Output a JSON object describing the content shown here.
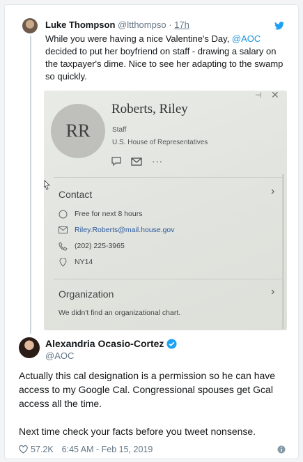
{
  "quoted_tweet": {
    "author_name": "Luke Thompson",
    "author_handle": "@ltthompso",
    "separator": "·",
    "time": "17h",
    "text_before": "While you were having a nice Valentine's Day, ",
    "mention": "@AOC",
    "text_after": " decided to put her boyfriend on staff - drawing a salary on the taxpayer's dime. Nice to see her adapting to the swamp so quickly."
  },
  "photo": {
    "pin_glyph": "⊣",
    "close_glyph": "✕",
    "initials": "RR",
    "name": "Roberts, Riley",
    "role": "Staff",
    "organization": "U.S. House of Representatives",
    "more_glyph": "···",
    "contact_header": "Contact",
    "chevron_glyph": "›",
    "contact_rows": [
      {
        "icon": "clock-icon",
        "text": "Free for next 8 hours"
      },
      {
        "icon": "mail-icon",
        "text": "Riley.Roberts@mail.house.gov"
      },
      {
        "icon": "phone-icon",
        "text": "(202) 225-3965"
      },
      {
        "icon": "location-icon",
        "text": "NY14"
      }
    ],
    "org_header": "Organization",
    "org_note": "We didn't find an organizational chart."
  },
  "reply_tweet": {
    "author_name": "Alexandria Ocasio-Cortez",
    "author_handle": "@AOC",
    "text": "Actually this cal designation is a permission so he can have access to my Google Cal. Congressional spouses get Gcal access all the time.\n\nNext time check your facts before you tweet nonsense.",
    "likes": "57.2K",
    "timestamp": "6:45 AM - Feb 15, 2019"
  },
  "colors": {
    "link": "#1b95e0",
    "secondary_text": "#657786",
    "verified": "#1da1f2",
    "twitter_blue": "#1da1f2"
  }
}
